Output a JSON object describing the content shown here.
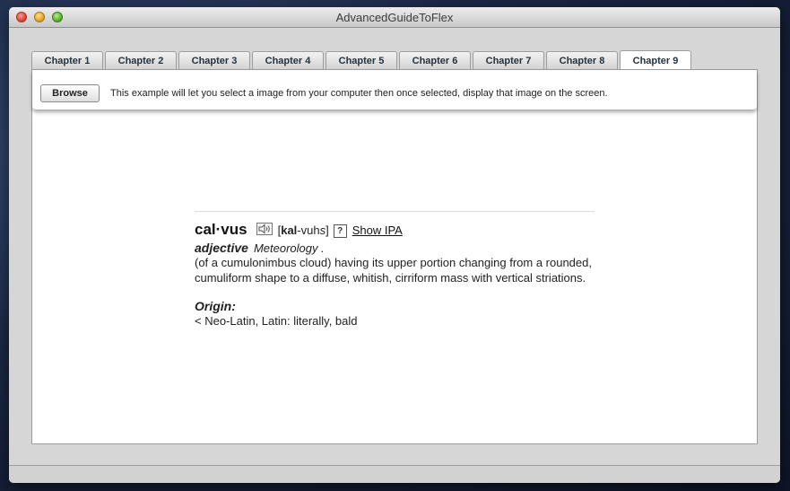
{
  "window": {
    "title": "AdvancedGuideToFlex"
  },
  "tabs": [
    {
      "label": "Chapter 1"
    },
    {
      "label": "Chapter 2"
    },
    {
      "label": "Chapter 3"
    },
    {
      "label": "Chapter 4"
    },
    {
      "label": "Chapter 5"
    },
    {
      "label": "Chapter 6"
    },
    {
      "label": "Chapter 7"
    },
    {
      "label": "Chapter 8"
    },
    {
      "label": "Chapter 9"
    }
  ],
  "active_tab": "Chapter 9",
  "toolbar": {
    "browse_label": "Browse",
    "description": "This example will let you select a image from your computer then once selected, display that image on the screen."
  },
  "dictionary": {
    "headword": "cal·vus",
    "pron_open": "[",
    "pron_stress": "kal",
    "pron_rest": "-vuh",
    "pron_italic": "s",
    "pron_close": "]",
    "help_glyph": "?",
    "show_ipa": "Show IPA",
    "part_of_speech": "adjective",
    "field": "Meteorology .",
    "definition": "(of a cumulonimbus cloud) having its upper portion changing from a rounded, cumuliform shape to a diffuse, whitish, cirriform mass with vertical striations.",
    "origin_label": "Origin:",
    "origin_text": "< Neo-Latin, Latin:  literally, bald"
  },
  "icons": {
    "speaker": "speaker-icon",
    "help": "help-icon"
  }
}
